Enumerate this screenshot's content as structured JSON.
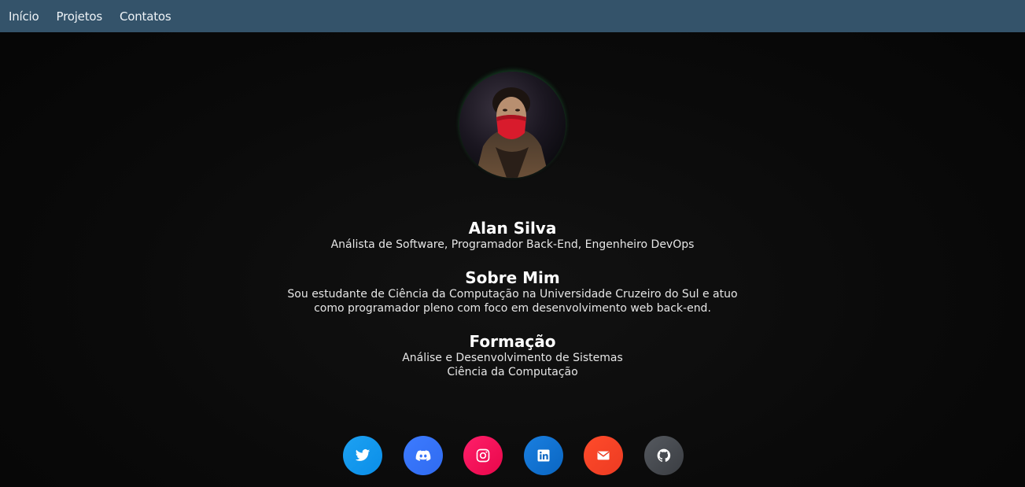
{
  "nav": {
    "items": [
      {
        "label": "Início"
      },
      {
        "label": "Projetos"
      },
      {
        "label": "Contatos"
      }
    ]
  },
  "profile": {
    "name": "Alan Silva",
    "role": "Análista de Software, Programador Back-End, Engenheiro DevOps"
  },
  "about": {
    "title": "Sobre Mim",
    "line1": "Sou estudante de Ciência da Computação na Universidade Cruzeiro do Sul e atuo",
    "line2": "como programador pleno com foco em desenvolvimento web back-end."
  },
  "formacao": {
    "title": "Formação",
    "items": [
      "Análise e Desenvolvimento de Sistemas",
      "Ciência da Computação"
    ]
  },
  "socials": [
    {
      "icon": "twitter-icon",
      "color": "#1da1f2"
    },
    {
      "icon": "discord-icon",
      "color": "#3d7bff"
    },
    {
      "icon": "instagram-icon",
      "color": "#ff1f6a"
    },
    {
      "icon": "linkedin-icon",
      "color": "#0a66c2"
    },
    {
      "icon": "email-icon",
      "color": "#ff4b2b"
    },
    {
      "icon": "github-icon",
      "color": "#4a4d52"
    }
  ],
  "colors": {
    "navbar": "#34536a",
    "background": "#0a0a0a",
    "text": "#ffffff"
  }
}
